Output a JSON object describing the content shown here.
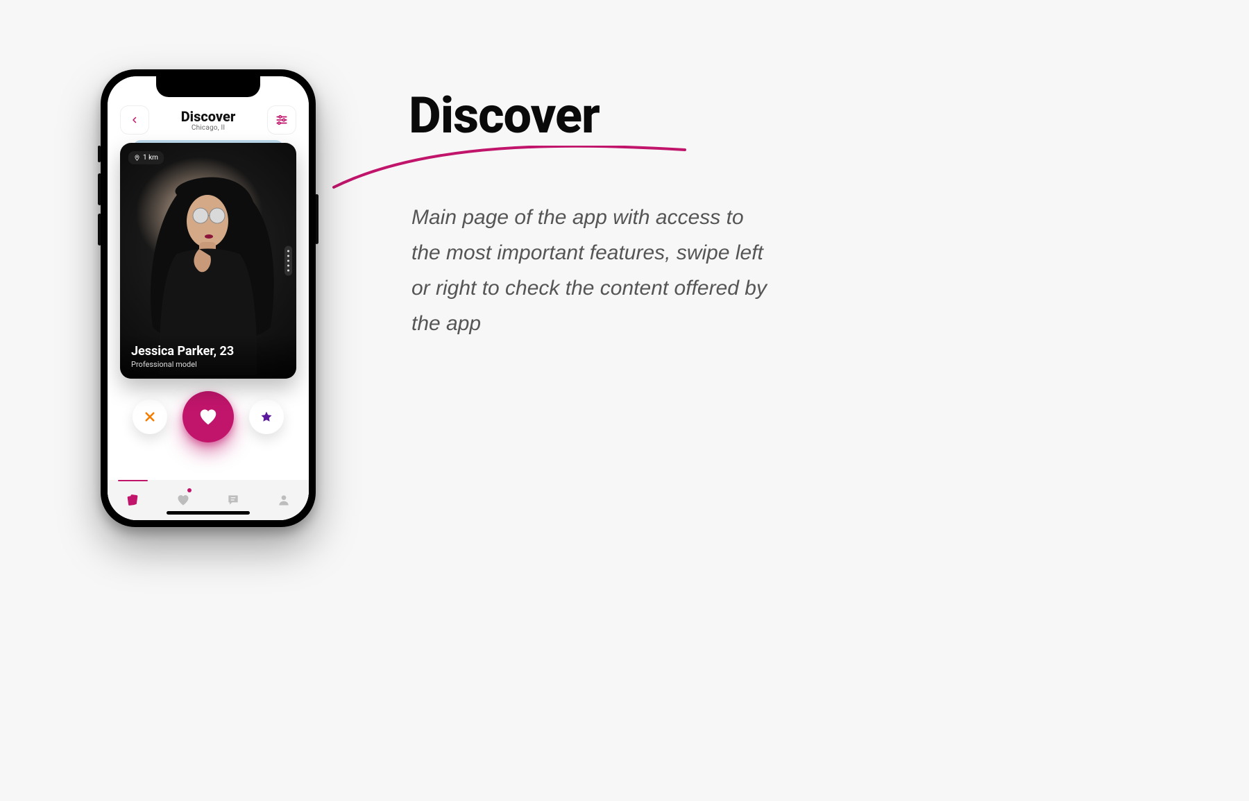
{
  "headline": "Discover",
  "blurb": "Main page of the app with access to the most important features, swipe left or right to check the content offered by the app",
  "colors": {
    "accent": "#c0156b",
    "orange": "#f57c00",
    "purple": "#5a189a",
    "muted": "#bdbdbd"
  },
  "app": {
    "header": {
      "title": "Discover",
      "subtitle": "Chicago, Il"
    },
    "card": {
      "distance": "1 km",
      "name": "Jessica Parker, 23",
      "subtitle": "Professional model"
    },
    "actions": {
      "pass": "pass",
      "like": "like",
      "star": "super-like"
    },
    "nav": {
      "items": [
        "discover",
        "likes",
        "chat",
        "profile"
      ],
      "active": "discover"
    }
  }
}
